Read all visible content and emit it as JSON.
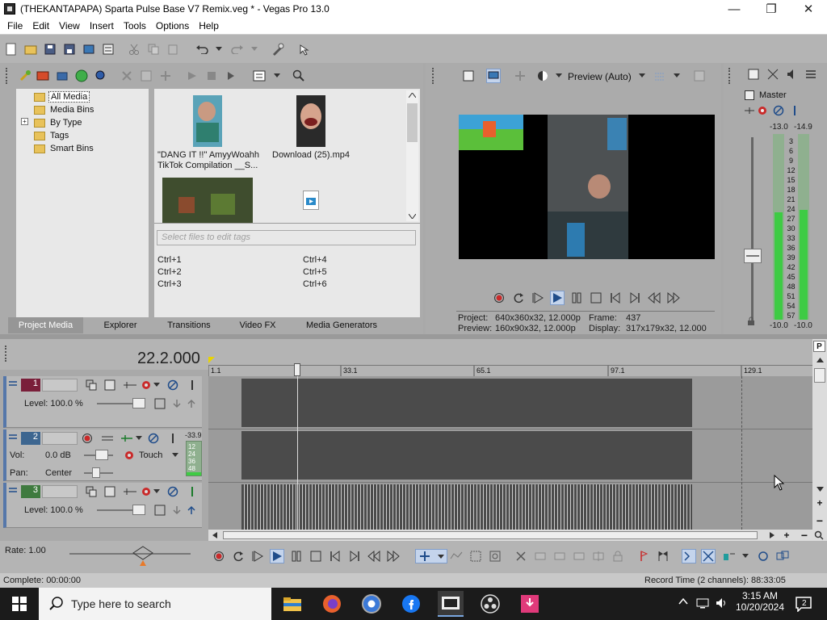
{
  "window": {
    "title": "(THEKANTAPAPA) Sparta Pulse Base V7 Remix.veg * - Vegas Pro 13.0",
    "minimize": "—",
    "maximize": "❐",
    "close": "✕"
  },
  "menu": [
    "File",
    "Edit",
    "View",
    "Insert",
    "Tools",
    "Options",
    "Help"
  ],
  "media_tree": [
    "All Media",
    "Media Bins",
    "By Type",
    "Tags",
    "Smart Bins"
  ],
  "media_items": [
    {
      "label": "\"DANG IT !!\" AmyyWoahh TikTok Compilation __S..."
    },
    {
      "label": "Download (25).mp4"
    }
  ],
  "tags_placeholder": "Select files to edit tags",
  "shortcuts": [
    "Ctrl+1",
    "Ctrl+4",
    "Ctrl+2",
    "Ctrl+5",
    "Ctrl+3",
    "Ctrl+6"
  ],
  "tabs": [
    "Project Media",
    "Explorer",
    "Transitions",
    "Video FX",
    "Media Generators"
  ],
  "preview": {
    "mode": "Preview (Auto)",
    "project_label": "Project:",
    "project_value": "640x360x32, 12.000p",
    "preview_label": "Preview:",
    "preview_value": "160x90x32, 12.000p",
    "frame_label": "Frame:",
    "frame_value": "437",
    "display_label": "Display:",
    "display_value": "317x179x32, 12.000"
  },
  "master": {
    "label": "Master",
    "peak_left": "-13.0",
    "peak_right": "-14.9",
    "scale": [
      "3",
      "6",
      "9",
      "12",
      "15",
      "18",
      "21",
      "24",
      "27",
      "30",
      "33",
      "36",
      "39",
      "42",
      "45",
      "48",
      "51",
      "54",
      "57"
    ],
    "bottom_left": "-10.0",
    "bottom_right": "-10.0",
    "level_left": 0.58,
    "level_right": 0.59
  },
  "timeline": {
    "time": "22.2.000",
    "ruler": [
      "1.1",
      "33.1",
      "65.1",
      "97.1",
      "129.1"
    ],
    "tracks": [
      {
        "number": "1",
        "level": "Level: 100.0 %"
      },
      {
        "number": "2",
        "vol_label": "Vol:",
        "vol_value": "0.0 dB",
        "pan_label": "Pan:",
        "pan_value": "Center",
        "automation": "Touch",
        "meter_peak": "-33.9",
        "meter_scale": [
          "12",
          "24",
          "36",
          "48"
        ]
      },
      {
        "number": "3",
        "level": "Level: 100.0 %"
      }
    ]
  },
  "transport": {
    "rate": "Rate: 1.00"
  },
  "status": {
    "complete": "Complete: 00:00:00",
    "record_time": "Record Time (2 channels): 88:33:05"
  },
  "taskbar": {
    "search_placeholder": "Type here to search",
    "time": "3:15 AM",
    "date": "10/20/2024",
    "notification_count": "2"
  }
}
